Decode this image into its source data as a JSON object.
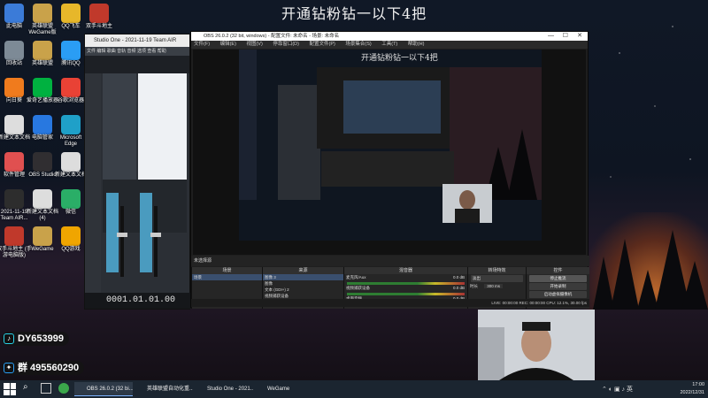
{
  "overlay_title": "开通钻粉钻一以下4把",
  "desktop": {
    "icons": [
      {
        "label": "此电脑",
        "icon": "computer-icon",
        "color": "#3b7bd8"
      },
      {
        "label": "英雄联盟\nWeGame版",
        "icon": "lol-icon",
        "color": "#c9a24a"
      },
      {
        "label": "QQ飞车",
        "icon": "qq-speed-icon",
        "color": "#e7b72a"
      },
      {
        "label": "双手斗地主",
        "icon": "poker-icon",
        "color": "#c0392b"
      },
      {
        "label": "回收站",
        "icon": "recycle-bin-icon",
        "color": "#7d8a96"
      },
      {
        "label": "英雄联盟",
        "icon": "lol-icon",
        "color": "#c9a24a"
      },
      {
        "label": "腾讯QQ",
        "icon": "qq-icon",
        "color": "#2a9df4"
      },
      {
        "label": "QQ飞车客服\n工具",
        "icon": "qq-speed-tool-icon",
        "color": "#e7b72a"
      },
      {
        "label": "向日葵",
        "icon": "sunflower-icon",
        "color": "#f07b1d"
      },
      {
        "label": "爱奇艺播放器",
        "icon": "iqiyi-icon",
        "color": "#00b140"
      },
      {
        "label": "谷歌浏览器",
        "icon": "chrome-icon",
        "color": "#e94235"
      },
      {
        "label": "鲁大师",
        "icon": "ludashi-icon",
        "color": "#2c8df4"
      },
      {
        "label": "新建文本文档",
        "icon": "text-file-icon",
        "color": "#dddddd"
      },
      {
        "label": "电脑管家",
        "icon": "pc-manager-icon",
        "color": "#2878e0"
      },
      {
        "label": "Microsoft\nEdge",
        "icon": "edge-icon",
        "color": "#1fa0c8"
      },
      {
        "label": "剪映专业版",
        "icon": "capcut-icon",
        "color": "#222222"
      },
      {
        "label": "软件管理",
        "icon": "software-icon",
        "color": "#e05050"
      },
      {
        "label": "OBS Studio",
        "icon": "obs-icon",
        "color": "#302e31"
      },
      {
        "label": "新建文本文档",
        "icon": "text-file-icon",
        "color": "#dddddd"
      },
      {
        "label": "腾讯QQ",
        "icon": "qq-icon",
        "color": "#2a9df4"
      },
      {
        "label": "2021-11-19\nTeam AIR...",
        "icon": "studio-one-icon",
        "color": "#2d2d2d"
      },
      {
        "label": "新建文本文档\n(4)",
        "icon": "text-file-icon",
        "color": "#dddddd"
      },
      {
        "label": "微信",
        "icon": "wechat-icon",
        "color": "#2aae67"
      },
      {
        "label": "QQ游戏",
        "icon": "qq-game-icon",
        "color": "#f0a500"
      },
      {
        "label": "双手斗地主\n(手游电脑版)",
        "icon": "poker-icon",
        "color": "#c0392b"
      },
      {
        "label": "WeGame",
        "icon": "wegame-icon",
        "color": "#c9a24a"
      },
      {
        "label": "QQ游戏",
        "icon": "qq-game-icon",
        "color": "#f0a500"
      },
      {
        "label": "360安全浏览\n器",
        "icon": "360-browser-icon",
        "color": "#3ba74b"
      }
    ]
  },
  "badges": [
    {
      "icon": "tiktok-icon",
      "text": "DY653999"
    },
    {
      "icon": "qq-group-icon",
      "text": "群 495560290"
    }
  ],
  "studio_one": {
    "title": "Studio One - 2021-11-19 Team AIR",
    "menu": "文件 编辑 歌曲 音轨 音频 选项 查看 帮助",
    "time": "0001.01.01.00"
  },
  "obs": {
    "title": "OBS 26.0.2 (32 bit, windows) - 配置文件: 未命名 - 场景: 未命名",
    "menu": [
      "文件(F)",
      "编辑(E)",
      "视图(V)",
      "停靠窗口(D)",
      "配置文件(P)",
      "场景集合(S)",
      "工具(T)",
      "帮助(H)"
    ],
    "preview_title": "开通钻粉钻一以下4把",
    "scene_bar": "未选择源",
    "docks": {
      "scenes": {
        "title": "场景",
        "items": [
          "场景"
        ]
      },
      "sources": {
        "title": "来源",
        "items": [
          "图像 3",
          "图像",
          "文本 (GDI+) 2",
          "视频捕获设备",
          "文本 (GDI+)",
          "显示器采集"
        ]
      },
      "mixer": {
        "title": "混音器",
        "items": [
          {
            "name": "麦克风/Aux",
            "level": "0.0 dB"
          },
          {
            "name": "视频捕获设备",
            "level": "0.0 dB"
          },
          {
            "name": "桌面音频",
            "level": "0.0 dB"
          }
        ]
      },
      "transitions": {
        "title": "转场特效",
        "type": "淡出",
        "duration_label": "时长",
        "duration": "300 ms"
      },
      "controls": {
        "title": "控件",
        "buttons": [
          "停止推流",
          "开始录制",
          "启动虚拟摄像机",
          "工作室模式",
          "设置",
          "退出"
        ]
      }
    },
    "status": "LIVE: 00:00:00   REC: 00:00:00   CPU: 12.1%, 30.00 fps"
  },
  "taskbar": {
    "items": [
      {
        "label": "OBS 26.0.2 (32 bi...",
        "icon": "obs-icon",
        "active": true
      },
      {
        "label": "英雄联盟自动化重...",
        "icon": "chrome-icon",
        "active": false
      },
      {
        "label": "Studio One - 2021...",
        "icon": "studio-one-icon",
        "active": false
      },
      {
        "label": "WeGame",
        "icon": "wegame-icon",
        "active": false
      }
    ],
    "time": "17:00",
    "date": "2022/12/31"
  }
}
